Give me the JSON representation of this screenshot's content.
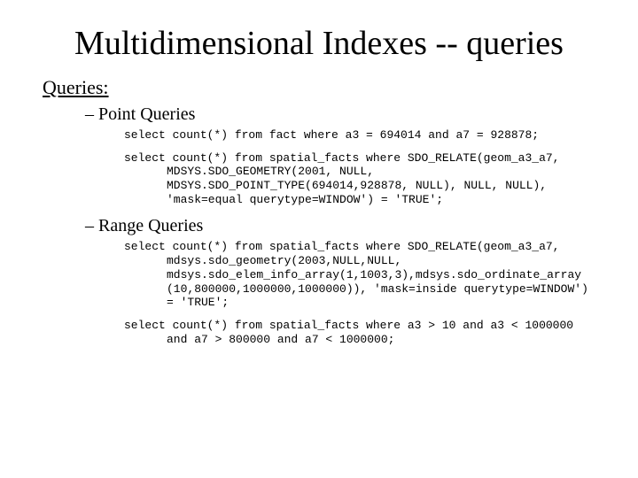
{
  "title": "Multidimensional Indexes -- queries",
  "section": "Queries:",
  "groups": [
    {
      "heading": "Point Queries",
      "code": [
        "select count(*) from fact where a3 = 694014 and a7 = 928878;",
        "select count(*) from spatial_facts where SDO_RELATE(geom_a3_a7, MDSYS.SDO_GEOMETRY(2001, NULL, MDSYS.SDO_POINT_TYPE(694014,928878, NULL), NULL, NULL), 'mask=equal querytype=WINDOW') = 'TRUE';"
      ]
    },
    {
      "heading": "Range Queries",
      "code": [
        "select count(*) from spatial_facts where SDO_RELATE(geom_a3_a7, mdsys.sdo_geometry(2003,NULL,NULL, mdsys.sdo_elem_info_array(1,1003,3),mdsys.sdo_ordinate_array (10,800000,1000000,1000000)), 'mask=inside querytype=WINDOW') = 'TRUE';",
        "select count(*) from spatial_facts where a3 > 10 and a3 < 1000000 and a7 > 800000 and a7 < 1000000;"
      ]
    }
  ]
}
